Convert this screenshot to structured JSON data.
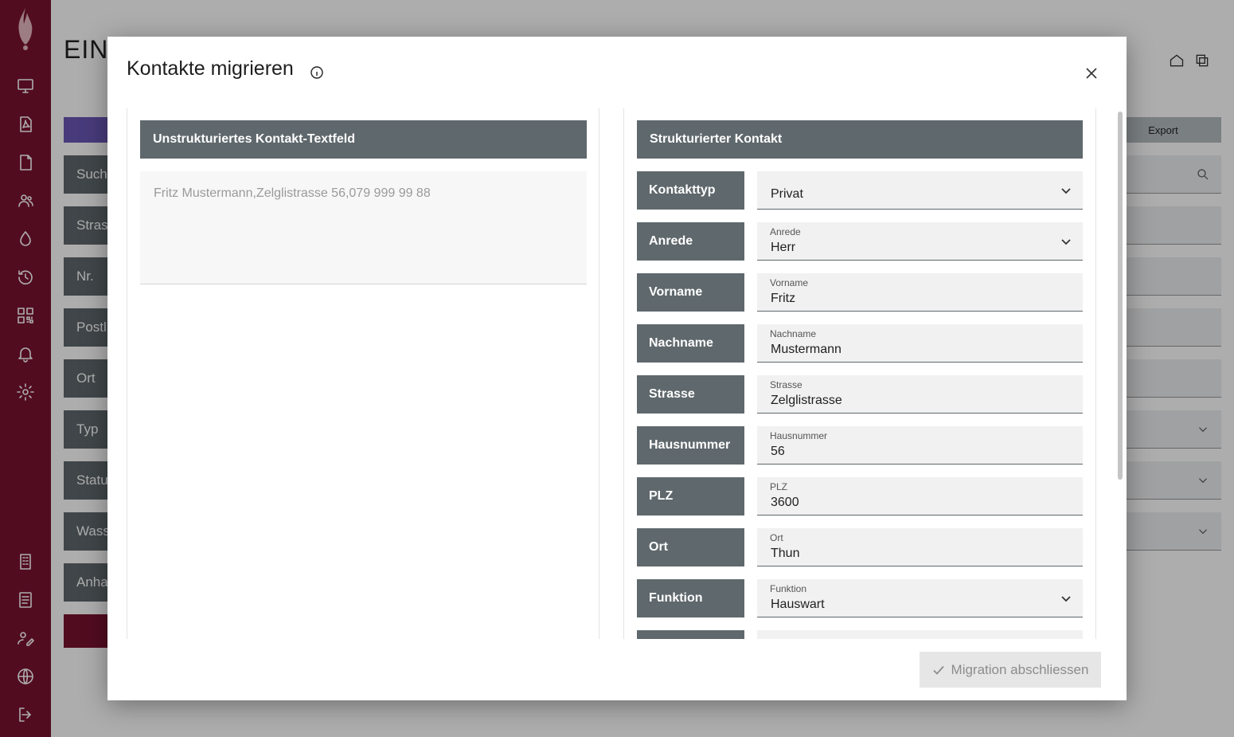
{
  "background": {
    "title": "EINS",
    "export_label": "Export",
    "labels": [
      "Suche",
      "Stras",
      "Nr.",
      "Postl",
      "Ort",
      "Typ",
      "Statu",
      "Wass",
      "Anha"
    ]
  },
  "modal": {
    "title": "Kontakte migrieren",
    "left_panel": {
      "header": "Unstrukturiertes Kontakt-Textfeld",
      "text": "Fritz Mustermann,Zelglistrasse 56,079 999 99 88"
    },
    "right_panel": {
      "header": "Strukturierter Kontakt",
      "rows": [
        {
          "label": "Kontakttyp",
          "field_label": "",
          "value": "Privat"
        },
        {
          "label": "Anrede",
          "field_label": "Anrede",
          "value": "Herr"
        },
        {
          "label": "Vorname",
          "field_label": "Vorname",
          "value": "Fritz"
        },
        {
          "label": "Nachname",
          "field_label": "Nachname",
          "value": "Mustermann"
        },
        {
          "label": "Strasse",
          "field_label": "Strasse",
          "value": "Zelglistrasse"
        },
        {
          "label": "Hausnummer",
          "field_label": "Hausnummer",
          "value": "56"
        },
        {
          "label": "PLZ",
          "field_label": "PLZ",
          "value": "3600"
        },
        {
          "label": "Ort",
          "field_label": "Ort",
          "value": "Thun"
        },
        {
          "label": "Funktion",
          "field_label": "Funktion",
          "value": "Hauswart"
        }
      ]
    },
    "finish_label": "Migration abschliessen"
  },
  "icons": {
    "sidebar": [
      "monitor-icon",
      "pdf-icon",
      "document-icon",
      "users-icon",
      "water-drop-icon",
      "history-icon",
      "qr-code-icon",
      "bell-icon",
      "gear-icon",
      "building-icon",
      "notebook-icon",
      "user-edit-icon",
      "globe-icon",
      "logout-icon"
    ],
    "accent": "#7a1330"
  }
}
